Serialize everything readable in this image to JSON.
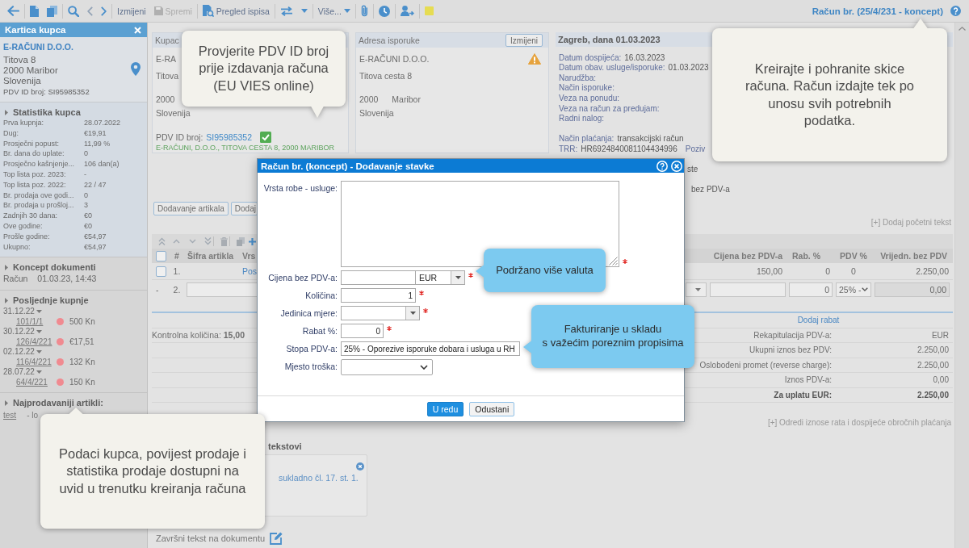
{
  "toolbar": {
    "edit": "Izmijeni",
    "save": {
      "label": "Spremi",
      "disabled": true
    },
    "print_preview": "Pregled ispisa",
    "more": "Više...",
    "document_title": "Račun br. (25/4/231 - koncept)"
  },
  "sidebar": {
    "title": "Kartica kupca",
    "customer": {
      "name": "E-RAČUNI D.O.O.",
      "address": [
        "Titova 8",
        "2000 Maribor",
        "Slovenija"
      ],
      "vat_id": "PDV ID broj: SI95985352"
    },
    "statistics": {
      "title": "Statistika kupca",
      "rows": [
        {
          "label": "Prva kupnja:",
          "value": "28.07.2022"
        },
        {
          "label": "Dug:",
          "value": "€19,91"
        },
        {
          "label": "Prosječni popust:",
          "value": "11,99 %"
        },
        {
          "label": "Br. dana do uplate:",
          "value": "0"
        },
        {
          "label": "Prosječno kašnjenje...",
          "value": "106 dan(a)"
        },
        {
          "label": "Top lista poz. 2023:",
          "value": "-"
        },
        {
          "label": "Top lista poz. 2022:",
          "value": "22 / 47"
        },
        {
          "label": "Br. prodaja ove godi...",
          "value": "0"
        },
        {
          "label": "Br. prodaja u prošloj...",
          "value": "3"
        },
        {
          "label": "Zadnjih 30 dana:",
          "value": "€0"
        },
        {
          "label": "Ove godine:",
          "value": "€0"
        },
        {
          "label": "Prošle godine:",
          "value": "€54,97"
        },
        {
          "label": "Ukupno:",
          "value": "€54,97"
        }
      ]
    },
    "drafts": {
      "title": "Koncept dokumenti",
      "items": [
        {
          "document": "Račun",
          "time": "01.03.23, 14:43"
        }
      ]
    },
    "recent_purchases": {
      "title": "Posljednje kupnje",
      "items": [
        {
          "date": "31.12.22",
          "number": "101/1/1",
          "amount": "500 Kn",
          "color": "#f08a90"
        },
        {
          "date": "30.12.22",
          "number": "126/4/221",
          "amount": "€17,51",
          "color": "#f08a90"
        },
        {
          "date": "02.12.22",
          "number": "116/4/221",
          "amount": "132 Kn",
          "color": "#f08a90"
        },
        {
          "date": "28.07.22",
          "number": "64/4/221",
          "amount": "150 Kn",
          "color": "#f08a90"
        }
      ]
    },
    "top_items": {
      "title": "Najprodavaniji artikli:",
      "items": [
        {
          "name": "test",
          "detail": "- lo"
        }
      ]
    }
  },
  "customer_panel": {
    "title": "Kupac",
    "name": "E-RA",
    "street": "Titova",
    "postcode": "2000",
    "country": "Slovenija",
    "vat_label": "PDV ID broj:",
    "vat_id": "SI95985352",
    "vat_verified": true,
    "vies_result": "E-RAČUNI, D.O.O., TITOVA CESTA 8, 2000 MARIBOR"
  },
  "delivery_panel": {
    "title": "Adresa isporuke",
    "edit_button": "Izmijeni",
    "name": "E-RAČUNI D.O.O.",
    "warning": true,
    "street": "Titova cesta 8",
    "postcode": "2000",
    "city": "Maribor",
    "country": "Slovenija"
  },
  "document_panel": {
    "title": "Zagreb, dana 01.03.2023",
    "fields": [
      {
        "label": "Datum dospijeća:",
        "value": "16.03.2023"
      },
      {
        "label": "Datum obav. usluge/isporuke:",
        "value": "01.03.2023"
      },
      {
        "label": "Narudžba:"
      },
      {
        "label": "Način isporuke:"
      },
      {
        "label": "Veza na ponudu:"
      },
      {
        "label": "Veza na račun za predujam:"
      },
      {
        "label": "Radni nalog:"
      }
    ],
    "payment": [
      {
        "label": "Način plaćanja:",
        "value": "transakcijski račun"
      },
      {
        "label": "TRR:",
        "value": "HR6924840081104434996",
        "reference_label": "Poziv"
      }
    ],
    "partly_hidden_lines": [
      "ste",
      "bez PDV-a"
    ]
  },
  "add_intro_text": "[+] Dodaj početni tekst",
  "item_buttons": [
    "Dodavanje artikala",
    "Dodaj"
  ],
  "items_table": {
    "header": {
      "checked": false,
      "columns_left": [
        "#",
        "Šifra artikla",
        "Vrs"
      ],
      "columns_right": [
        "Cijena bez PDV-a",
        "Rab. %",
        "PDV %",
        "Vrijedn. bez PDV"
      ]
    },
    "rows": [
      {
        "kind": "item",
        "checked": false,
        "number": "1.",
        "name": "Pos",
        "price": "150,00",
        "discount": "0",
        "vat": "0",
        "value": "2.250,00"
      },
      {
        "kind": "new",
        "marker": "-",
        "number": "2.",
        "discount": "0",
        "vat": "25% -",
        "value": "0,00"
      }
    ]
  },
  "summary": {
    "add_discount": "Dodaj rabat",
    "control_quantity": "Kontrolna količina: **15,00**",
    "rows": [
      {
        "kind": "line",
        "label": "Rekapitulacija PDV-a:",
        "value": "EUR"
      },
      {
        "kind": "line",
        "label": "Ukupni iznos bez PDV:",
        "value": "2.250,00"
      },
      {
        "kind": "line",
        "label": "Oslobođeni promet (reverse charge):",
        "value": "2.250,00"
      },
      {
        "kind": "line",
        "label": "Iznos PDV-a:",
        "value": "0,00"
      },
      {
        "kind": "total",
        "label": "Za uplatu EUR:",
        "value": "2.250,00"
      }
    ]
  },
  "installments_link": "[+] Odredi iznose rata i dospijeće obročnih plaćanja",
  "final_texts": {
    "heading": "tekstovi",
    "items": [
      "sukladno čl. 17. st. 1."
    ]
  },
  "document_end_text": "Završni tekst na dokumentu",
  "dialog": {
    "title": "Račun br. (koncept) - Dodavanje stavke",
    "fields": [
      {
        "kind": "textarea",
        "label": "Vrsta robe - usluge:",
        "required": true
      },
      {
        "kind": "price",
        "label": "Cijena bez PDV-a:",
        "currency": "EUR",
        "required": true
      },
      {
        "kind": "number",
        "label": "Količina:",
        "value": "1",
        "required": true
      },
      {
        "kind": "combo",
        "label": "Jedinica mjere:",
        "required": true
      },
      {
        "kind": "short-number",
        "label": "Rabat %:",
        "value": "0",
        "required": true
      },
      {
        "kind": "select-wide",
        "label": "Stopa PDV-a:",
        "value": "25% - Oporezive isporuke dobara i usluga u RH",
        "required": false
      },
      {
        "kind": "select",
        "label": "Mjesto troška:",
        "required": false
      }
    ],
    "buttons": [
      {
        "label": "U redu",
        "primary": true
      },
      {
        "label": "Odustani",
        "primary": false
      }
    ]
  },
  "callouts": [
    {
      "kind": "note",
      "text": "Provjerite PDV ID broj\nprije izdavanja računa\n(EU VIES online)"
    },
    {
      "kind": "note",
      "text": "Kreirajte i pohranite skice\nračuna. Račun izdajte tek po\nunosu svih potrebnih\npodatka."
    },
    {
      "kind": "info",
      "text": "Podržano više valuta"
    },
    {
      "kind": "info",
      "text": "Fakturiranje u skladu\ns važećim poreznim propisima"
    },
    {
      "kind": "note",
      "text": "Podaci kupca, povijest prodaje i\nstatistika prodaje dostupni na\nuvid u trenutku kreiranja računa"
    }
  ]
}
